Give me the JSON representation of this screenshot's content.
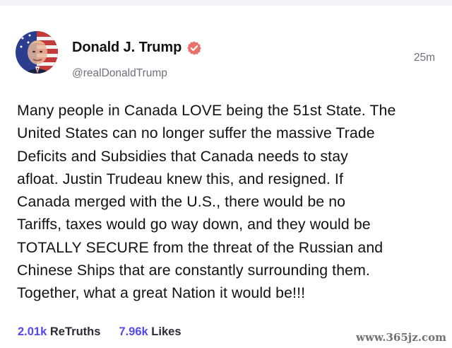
{
  "post": {
    "author": {
      "display_name": "Donald J. Trump",
      "handle": "@realDonaldTrump",
      "verified": true,
      "avatar_icon": "avatar-portrait"
    },
    "timestamp": "25m",
    "body_lines": [
      "Many people in Canada LOVE being the 51st State. The",
      "United States can no longer suffer the massive Trade",
      "Deficits and Subsidies that Canada needs to stay",
      "afloat. Justin Trudeau knew this, and resigned. If",
      "Canada merged with the U.S., there would be no",
      "Tariffs, taxes would go way down, and they would be",
      "TOTALLY SECURE from the threat of the Russian and",
      "Chinese Ships that are constantly surrounding them.",
      "Together, what a great Nation it would be!!!"
    ],
    "stats": {
      "retruths_value": "2.01k",
      "retruths_label": "ReTruths",
      "likes_value": "7.96k",
      "likes_label": "Likes"
    }
  },
  "watermark": "www.365jz.com",
  "colors": {
    "accent": "#5448ee",
    "verified_badge": "#e8716b",
    "muted_text": "#6f6f7d"
  }
}
